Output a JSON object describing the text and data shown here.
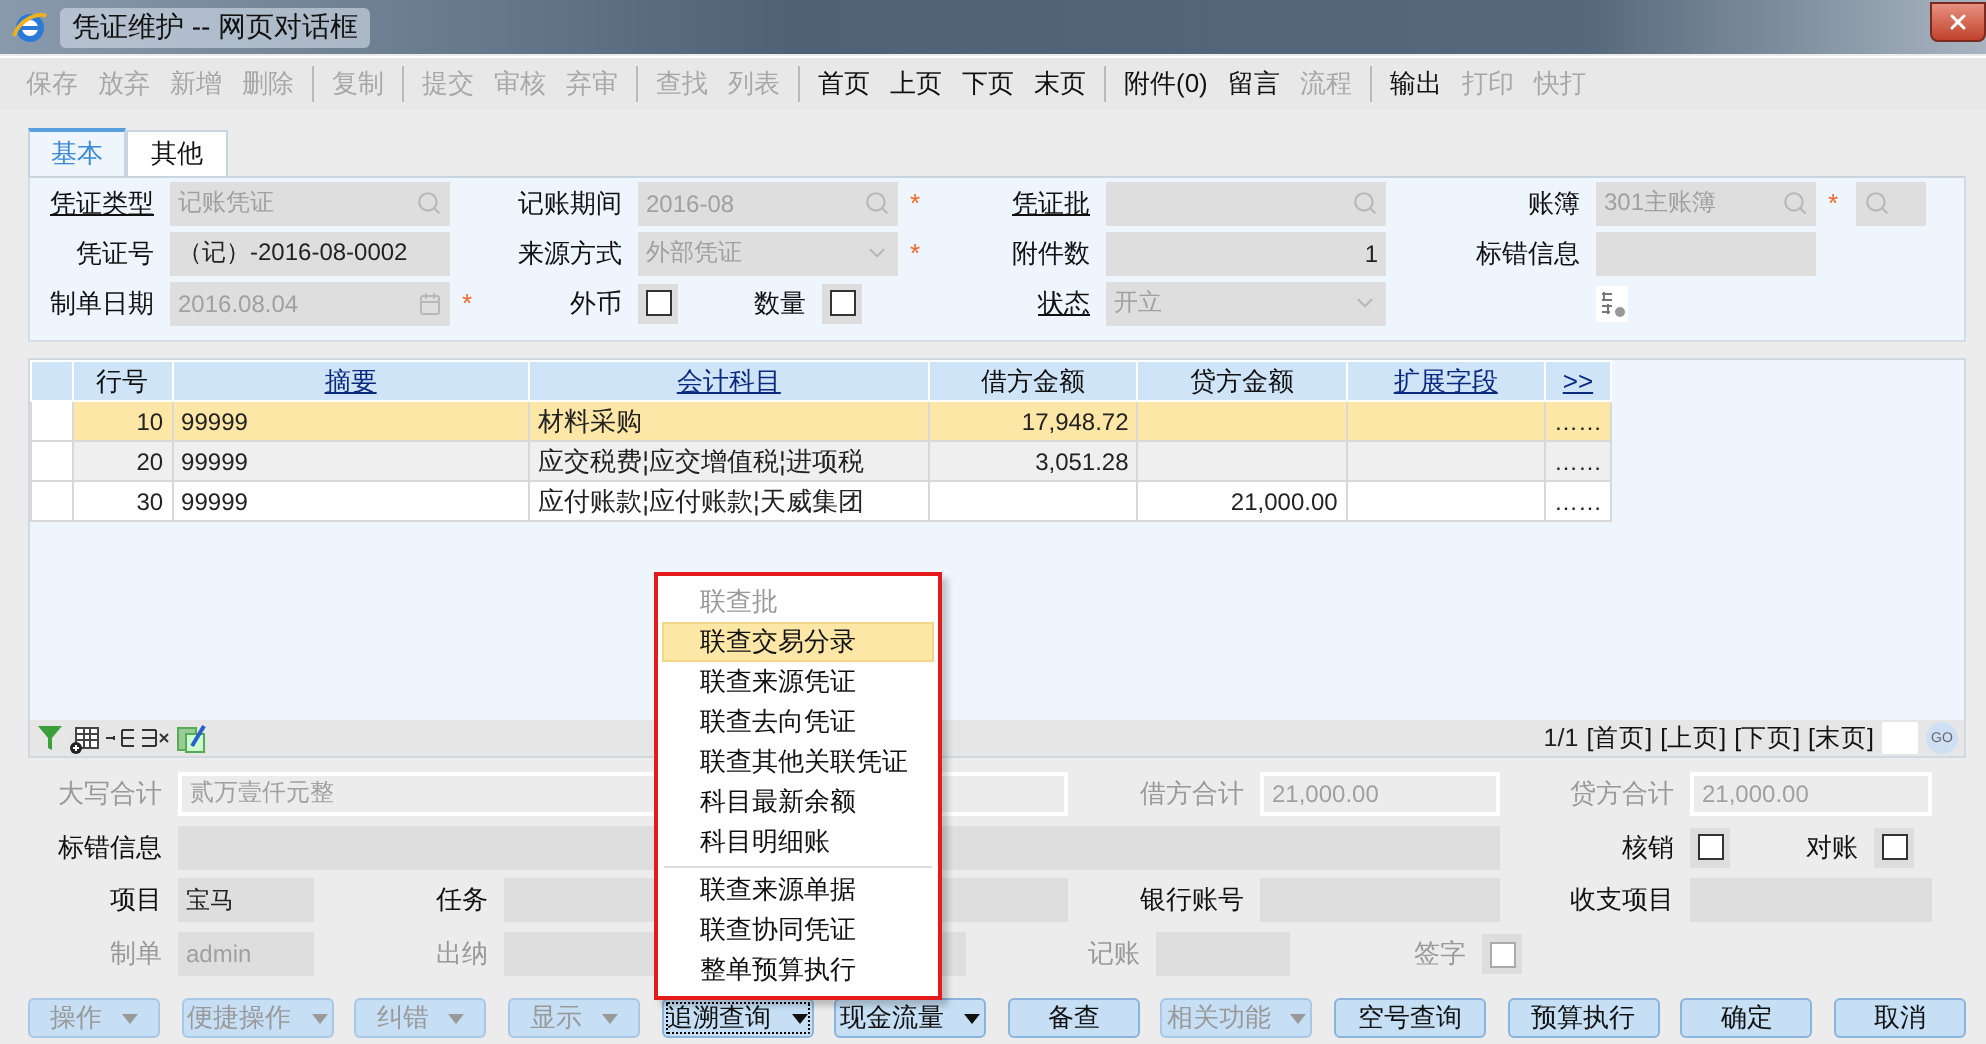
{
  "window": {
    "title": "凭证维护 -- 网页对话框"
  },
  "toolbar": [
    [
      {
        "label": "保存",
        "disabled": true
      },
      {
        "label": "放弃",
        "disabled": true
      },
      {
        "label": "新增",
        "disabled": true
      },
      {
        "label": "删除",
        "disabled": true
      }
    ],
    [
      {
        "label": "复制",
        "disabled": true
      }
    ],
    [
      {
        "label": "提交",
        "disabled": true
      },
      {
        "label": "审核",
        "disabled": true
      },
      {
        "label": "弃审",
        "disabled": true
      }
    ],
    [
      {
        "label": "查找",
        "disabled": true
      },
      {
        "label": "列表",
        "disabled": true
      }
    ],
    [
      {
        "label": "首页",
        "disabled": false
      },
      {
        "label": "上页",
        "disabled": false
      },
      {
        "label": "下页",
        "disabled": false
      },
      {
        "label": "末页",
        "disabled": false
      }
    ],
    [
      {
        "label": "附件(0)",
        "disabled": false
      },
      {
        "label": "留言",
        "disabled": false
      },
      {
        "label": "流程",
        "disabled": true
      }
    ],
    [
      {
        "label": "输出",
        "disabled": false
      },
      {
        "label": "打印",
        "disabled": true
      },
      {
        "label": "快打",
        "disabled": true
      }
    ]
  ],
  "tabs": [
    {
      "label": "基本",
      "selected": true
    },
    {
      "label": "其他",
      "selected": false
    }
  ],
  "header_form": [
    [
      {
        "kind": "field",
        "label": "凭证类型",
        "link": true,
        "value": "记账凭证",
        "disabled": true
      },
      {
        "kind": "field",
        "label": "记账期间",
        "link": false,
        "value": "2016-08",
        "disabled": true,
        "required_mark": "*"
      },
      {
        "kind": "field",
        "label": "凭证批",
        "link": true
      },
      {
        "kind": "field",
        "label": "账簿",
        "link": false,
        "value": "301主账簿",
        "disabled": true,
        "required_mark": "*"
      }
    ],
    [
      {
        "kind": "field",
        "label": "凭证号",
        "link": false,
        "value": "（记）-2016-08-0002",
        "disabled": false
      },
      {
        "kind": "field",
        "label": "来源方式",
        "link": false,
        "value": "外部凭证",
        "disabled": true,
        "required_mark": "*"
      },
      {
        "kind": "field",
        "label": "附件数",
        "link": false,
        "value": "1",
        "disabled": false
      },
      {
        "kind": "field",
        "label": "标错信息",
        "link": false
      }
    ],
    [
      {
        "kind": "field",
        "label": "制单日期",
        "link": false,
        "value": "2016.08.04",
        "disabled": true,
        "required_mark": "*"
      },
      {
        "kind": "checks",
        "items": [
          {
            "label": "外币",
            "checked": false
          },
          {
            "label": "数量",
            "checked": false
          }
        ]
      },
      {
        "kind": "field",
        "label": "状态",
        "link": true,
        "value": "开立",
        "disabled": true
      },
      {
        "kind": "icon_button"
      }
    ]
  ],
  "table": {
    "columns": [
      {
        "label": "行号",
        "link": false
      },
      {
        "label": "摘要",
        "link": true
      },
      {
        "label": "会计科目",
        "link": true
      },
      {
        "label": "借方金额",
        "link": false
      },
      {
        "label": "贷方金额",
        "link": false
      },
      {
        "label": "扩展字段",
        "link": true
      },
      {
        "label": ">>",
        "link": true
      }
    ],
    "rows": [
      {
        "selected": true,
        "cells": [
          "10",
          "99999",
          "材料采购",
          "17,948.72",
          "",
          "",
          "……"
        ]
      },
      {
        "selected": false,
        "cells": [
          "20",
          "99999",
          "应交税费¦应交增值税¦进项税",
          "3,051.28",
          "",
          "",
          "……"
        ]
      },
      {
        "selected": false,
        "cells": [
          "30",
          "99999",
          "应付账款¦应付账款¦天威集团",
          "",
          "21,000.00",
          "",
          "……"
        ]
      }
    ]
  },
  "pager": {
    "position": "1/1",
    "links": [
      "[首页]",
      "[上页]",
      "[下页]",
      "[末页]"
    ],
    "go": "GO"
  },
  "summary_form": [
    [
      {
        "kind": "field",
        "label": "大写合计",
        "value": "贰万壹仟元整",
        "disabled": true
      },
      {
        "kind": "field",
        "label": "借方合计",
        "value": "21,000.00",
        "disabled": true
      },
      {
        "kind": "field",
        "label": "贷方合计",
        "value": "21,000.00",
        "disabled": true
      }
    ],
    [
      {
        "kind": "field",
        "label": "标错信息",
        "disabled": false
      },
      {
        "kind": "check",
        "label": "核销",
        "checked": false,
        "disabled": false
      },
      {
        "kind": "check",
        "label": "对账",
        "checked": false,
        "disabled": false
      }
    ],
    [
      {
        "kind": "field",
        "label": "项目",
        "value": "宝马",
        "disabled": false
      },
      {
        "kind": "field",
        "label": "任务",
        "disabled": false
      },
      {
        "kind": "field",
        "label": "银行账号",
        "disabled": false
      },
      {
        "kind": "field",
        "label": "收支项目",
        "disabled": false
      }
    ],
    [
      {
        "kind": "field",
        "label": "制单",
        "value": "admin",
        "disabled": true
      },
      {
        "kind": "field",
        "label": "出纳",
        "disabled": true
      },
      {
        "kind": "field",
        "label": "记账",
        "disabled": true
      },
      {
        "kind": "check",
        "label": "签字",
        "checked": false,
        "disabled": true
      }
    ]
  ],
  "menu": [
    {
      "label": "联查批",
      "disabled": true,
      "selected": false
    },
    {
      "label": "联查交易分录",
      "disabled": false,
      "selected": true
    },
    {
      "label": "联查来源凭证",
      "disabled": false,
      "selected": false
    },
    {
      "label": "联查去向凭证",
      "disabled": false,
      "selected": false
    },
    {
      "label": "联查其他关联凭证",
      "disabled": false,
      "selected": false
    },
    {
      "label": "科目最新余额",
      "disabled": false,
      "selected": false
    },
    {
      "label": "科目明细账",
      "disabled": false,
      "selected": false,
      "separator_after": true
    },
    {
      "label": "联查来源单据",
      "disabled": false,
      "selected": false
    },
    {
      "label": "联查协同凭证",
      "disabled": false,
      "selected": false
    },
    {
      "label": "整单预算执行",
      "disabled": false,
      "selected": false
    }
  ],
  "buttons": [
    {
      "label": "操作",
      "dropdown": true,
      "disabled": true,
      "open": false
    },
    {
      "label": "便捷操作",
      "dropdown": true,
      "disabled": true,
      "open": false
    },
    {
      "label": "纠错",
      "dropdown": true,
      "disabled": true,
      "open": false
    },
    {
      "label": "显示",
      "dropdown": true,
      "disabled": true,
      "open": false
    },
    {
      "label": "追溯查询",
      "dropdown": true,
      "disabled": false,
      "open": true
    },
    {
      "label": "现金流量",
      "dropdown": true,
      "disabled": false,
      "open": false
    },
    {
      "label": "备查",
      "dropdown": false,
      "disabled": false,
      "open": false
    },
    {
      "label": "相关功能",
      "dropdown": true,
      "disabled": true,
      "open": false
    },
    {
      "label": "空号查询",
      "dropdown": false,
      "disabled": false,
      "open": false
    },
    {
      "label": "预算执行",
      "dropdown": false,
      "disabled": false,
      "open": false
    },
    {
      "label": "确定",
      "dropdown": false,
      "disabled": false,
      "open": false
    },
    {
      "label": "取消",
      "dropdown": false,
      "disabled": false,
      "open": false
    }
  ]
}
